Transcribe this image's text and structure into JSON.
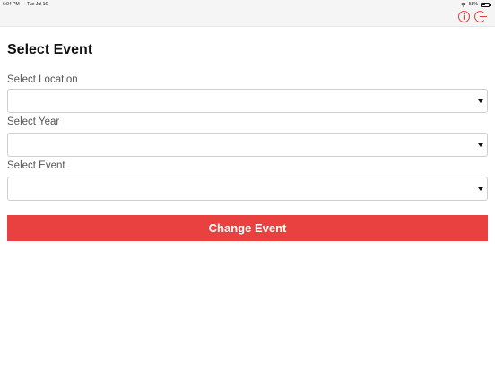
{
  "status_bar": {
    "time": "6:04 PM",
    "date": "Tue Jul 16",
    "battery": "58%",
    "battery_level": 0.58
  },
  "nav": {
    "info_icon": "info-circle-icon",
    "logout_icon": "logout-icon",
    "accent_color": "#e94040"
  },
  "page": {
    "title": "Select Event"
  },
  "form": {
    "location": {
      "label": "Select Location",
      "value": ""
    },
    "year": {
      "label": "Select Year",
      "value": ""
    },
    "event": {
      "label": "Select Event",
      "value": ""
    }
  },
  "actions": {
    "change_event_label": "Change Event",
    "button_color": "#e94040"
  }
}
